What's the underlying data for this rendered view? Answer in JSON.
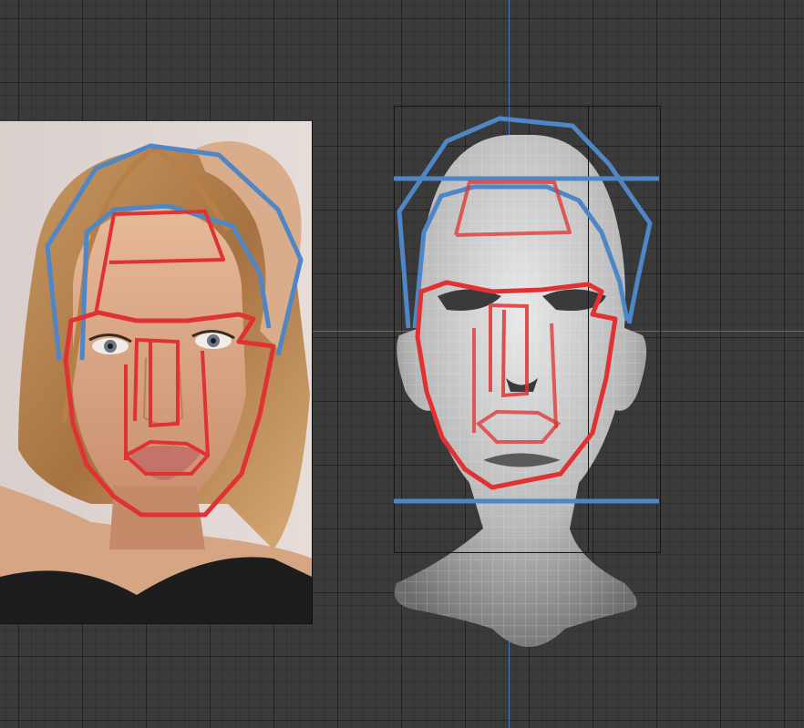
{
  "viewport": {
    "background": "#3a3a3a",
    "x_axis_color": "#c0444a",
    "y_axis_color": "#4a78b8"
  },
  "reference_image": {
    "subject": "portrait-photo",
    "guide_colors": {
      "red": "#e03232",
      "blue": "#4f86c6"
    }
  },
  "model": {
    "subject": "3d-head-mesh",
    "mesh_color": "#c8c8c8",
    "guide_colors": {
      "red": "#e03232",
      "blue": "#4f86c6"
    }
  }
}
